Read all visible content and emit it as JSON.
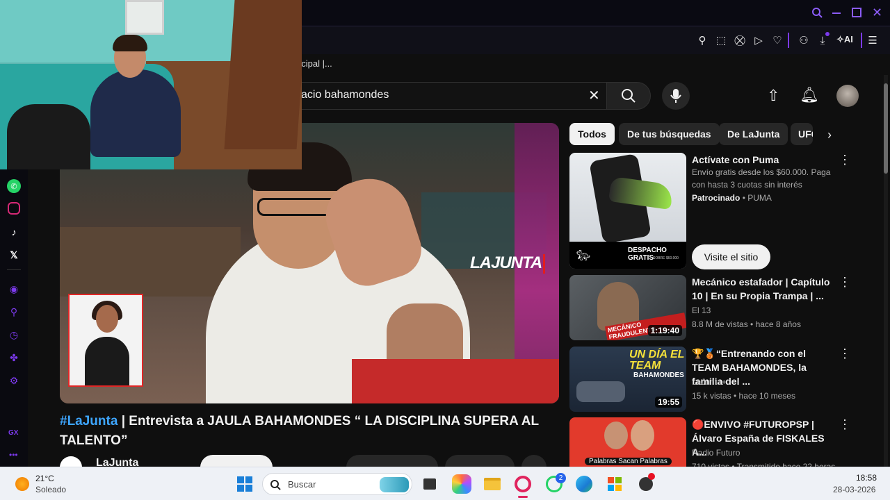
{
  "browser": {
    "tab_title_fragment": "ncipal |...",
    "ai_label": "AI"
  },
  "search": {
    "query": "acio bahamondes"
  },
  "video": {
    "title_hashtag": "#LaJunta",
    "title_rest": " | Entrevista a JAULA BAHAMONDES “ LA DISCIPLINA SUPERA AL TALENTO”",
    "channel": "LaJunta",
    "overlay_logo": "LAJUNTA"
  },
  "chips": [
    "Todos",
    "De tus búsquedas",
    "De LaJunta",
    "UFC"
  ],
  "recommendations": [
    {
      "title": "Actívate con Puma",
      "description": "Envío gratis desde los $60.000. Paga con hasta 3 cuotas sin interés",
      "sponsored_label": "Patrocinado",
      "advertiser": "PUMA",
      "cta": "Visite el sitio",
      "thumb_text": "DESPACHO GRATIS",
      "thumb_subtext": "SOBRE $60.000"
    },
    {
      "title": "Mecánico estafador | Capítulo 10 | En su Propia Trampa | ...",
      "channel": "El 13",
      "meta": "8.8 M de vistas • hace 8 años",
      "duration": "1:19:40",
      "thumb_text": "MECÁNICO FRAUDULENTO"
    },
    {
      "title": "🏆🥉“Entrenando con el TEAM BAHAMONDES, la familia del ...",
      "channel": "LaJunta+",
      "meta": "15 k vistas • hace 10 meses",
      "duration": "19:55",
      "thumb_text": "UN DÍA EL TEAM",
      "thumb_subtext": "BAHAMONDES"
    },
    {
      "title": "🔴ENVIVO #FUTUROPSP | Álvaro España de FISKALES A...",
      "channel": "Radio Futuro",
      "meta": "710 vistas • Transmitido hace 22 horas",
      "thumb_text": "Palabras Sacan Palabras"
    }
  ],
  "taskbar": {
    "weather_temp": "21°C",
    "weather_desc": "Soleado",
    "search_placeholder": "Buscar",
    "time": "18:58",
    "date": "28-03-2026",
    "whatsapp_badge": "2"
  },
  "gx_label": "GX",
  "colors": {
    "accent": "#7c3aed",
    "link": "#3ea6ff",
    "brand_red": "#e21d1d"
  }
}
